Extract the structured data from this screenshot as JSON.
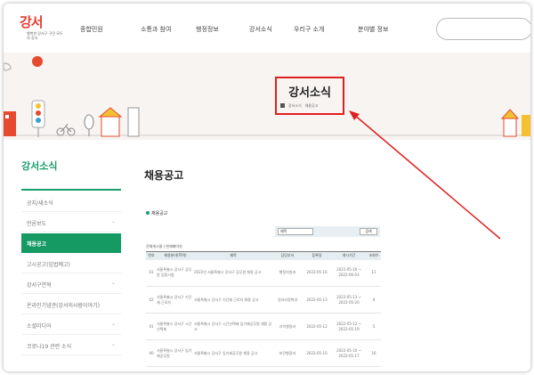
{
  "header": {
    "logo_text": "강서",
    "logo_sub": "행복한 강서구 구민 모두의 강서",
    "nav": [
      "종합민원",
      "소통과 참여",
      "행정정보",
      "강서소식",
      "우리구 소개",
      "분야별 정보"
    ]
  },
  "banner": {
    "title": "강서소식",
    "breadcrumbs": [
      "강서소식",
      "채용공고"
    ]
  },
  "sidebar": {
    "title": "강서소식",
    "items": [
      {
        "label": "공지/새소식",
        "has_chevron": false,
        "active": false
      },
      {
        "label": "언론보도",
        "has_chevron": true,
        "active": false
      },
      {
        "label": "채용공고",
        "has_chevron": false,
        "active": true
      },
      {
        "label": "고시공고(입법예고)",
        "has_chevron": false,
        "active": false
      },
      {
        "label": "강서구연혁",
        "has_chevron": true,
        "active": false
      },
      {
        "label": "온라인기념관(강서의사람이야기)",
        "has_chevron": false,
        "active": false
      },
      {
        "label": "소셜미디어",
        "has_chevron": true,
        "active": false
      },
      {
        "label": "코로나19 관련 소식",
        "has_chevron": true,
        "active": false
      }
    ]
  },
  "main": {
    "page_title": "채용공고",
    "sub_heading": "채용공고",
    "search": {
      "select_value": "제목",
      "button_label": "검색"
    },
    "count_text": "전체게시물 | 현재페이지",
    "table": {
      "headers": [
        "번호",
        "채용분야(학력)",
        "제목",
        "담당부서",
        "등록일",
        "게시기간",
        "조회수"
      ],
      "rows": [
        [
          "03",
          "서울특별시 강서구 공무원 임용시험",
          "2022년 서울특별시 강서구 공무원 채용 공고",
          "행정지원과",
          "2022-05-16",
          "2022-05-16 ~ 2022-06-03",
          "11"
        ],
        [
          "02",
          "서울특별시 강서구 기간제 근로자",
          "서울특별시 강서구 기간제 근로자 채용 공고",
          "일자리정책과",
          "2022-05-13",
          "2022-05-13 ~ 2022-05-20",
          "4"
        ],
        [
          "01",
          "서울특별시 강서구 시간선택제",
          "서울특별시 강서구 시간선택제 임기제공무원 채용 공고",
          "자치행정과",
          "2022-05-12",
          "2022-05-12 ~ 2022-05-19",
          "5"
        ],
        [
          "00",
          "서울특별시 강서구 임기제공무원",
          "서울특별시 강서구 임기제공무원 채용 공고",
          "보건행정과",
          "2022-05-10",
          "2022-05-10 ~ 2022-05-17",
          "16"
        ]
      ]
    }
  },
  "colors": {
    "accent_green": "#159a63",
    "highlight_red": "#e02020"
  }
}
